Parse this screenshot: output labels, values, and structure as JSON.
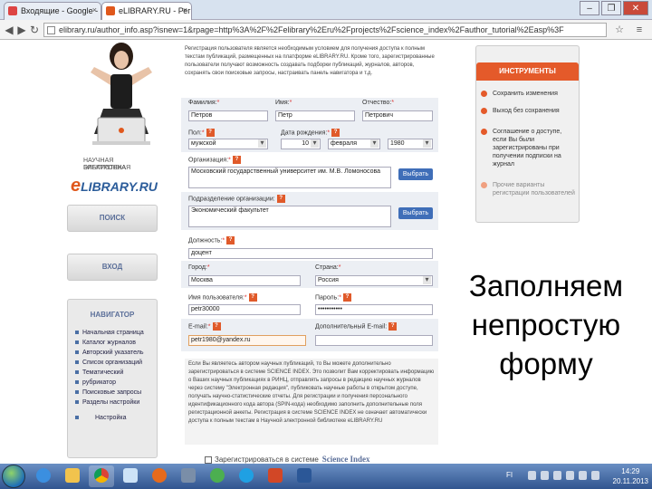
{
  "browser": {
    "tabs": [
      {
        "label": "Входящие - Google - мар",
        "active": false
      },
      {
        "label": "eLIBRARY.RU - Регистрац",
        "active": true
      }
    ],
    "url": "elibrary.ru/author_info.asp?isnew=1&rpage=http%3A%2F%2Felibrary%2Eru%2Fprojects%2Fscience_index%2Fauthor_tutorial%2Easp%3F",
    "window_buttons": {
      "minimize": "–",
      "maximize": "❐",
      "close": "✕"
    },
    "nav": {
      "back": "◀",
      "forward": "▶",
      "reload": "↻"
    }
  },
  "sidebar": {
    "logo_line1": "НАУЧНАЯ ЭЛЕКТРОННАЯ",
    "logo_line2": "БИБЛИОТЕКА",
    "logo_brand": "LIBRARY.RU",
    "logo_brand_e": "e",
    "search_label": "ПОИСК",
    "login_label": "ВХОД",
    "navigator": {
      "title": "НАВИГАТОР",
      "items": [
        "Начальная страница",
        "Каталог журналов",
        "Авторский указатель",
        "Список организаций",
        "Тематический",
        "рубрикатор",
        "Поисковые запросы",
        "Разделы настройки"
      ],
      "footer": "Настройка"
    }
  },
  "form": {
    "intro": "Регистрация пользователя является необходимым условием для получения доступа к полным текстам публикаций, размещенных на платформе eLIBRARY.RU. Кроме того, зарегистрированные пользователи получают возможность создавать подборки публикаций, журналов, авторов, сохранять свои поисковые запросы, настраивать панель навигатора и т.д.",
    "lastname": {
      "label": "Фамилия:",
      "value": "Петров"
    },
    "firstname": {
      "label": "Имя:",
      "value": "Петр"
    },
    "middlename": {
      "label": "Отчество:",
      "value": "Петрович"
    },
    "gender": {
      "label": "Пол:",
      "value": "мужской"
    },
    "birthdate": {
      "label": "Дата рождения:",
      "day": "10",
      "month": "февраля",
      "year": "1980"
    },
    "organization": {
      "label": "Организация:",
      "value": "Московский государственный университет им. М.В. Ломоносова",
      "button": "Выбрать"
    },
    "department": {
      "label": "Подразделение организации:",
      "value": "Экономический факультет",
      "button": "Выбрать"
    },
    "position": {
      "label": "Должность:",
      "value": "доцент"
    },
    "city": {
      "label": "Город:",
      "value": "Москва"
    },
    "country": {
      "label": "Страна:",
      "value": "Россия"
    },
    "username": {
      "label": "Имя пользователя:",
      "value": "petr30000"
    },
    "password": {
      "label": "Пароль:",
      "value": "•••••••••••"
    },
    "email": {
      "label": "E-mail:",
      "value": "petr1980@yandex.ru"
    },
    "extra_email": {
      "label": "Дополнительный E-mail:",
      "value": ""
    },
    "bottom_text": "Если Вы являетесь автором научных публикаций, то Вы можете дополнительно зарегистрироваться в системе SCIENCE INDEX. Это позволит Вам корректировать информацию о Ваших научных публикациях в РИНЦ, отправлять запросы в редакцию научных журналов через систему \"Электронная редакция\", публиковать научные работы в открытом доступе, получать научно-статистические отчеты. Для регистрации и получения персонального идентификационного кода автора (SPIN-кода) необходимо заполнить дополнительные поля регистрационной анкеты. Регистрация в системе SCIENCE INDEX не означает автоматически доступа к полным текстам в Научной электронной библиотеке eLIBRARY.RU",
    "science_index_check": "Зарегистрироваться в системе",
    "science_index_logo": "Science Index"
  },
  "instruments": {
    "title": "ИНСТРУМЕНТЫ",
    "items": [
      {
        "label": "Сохранить изменения",
        "dim": false
      },
      {
        "label": "Выход без сохранения",
        "dim": false
      },
      {
        "label": "Соглашение о доступе, если Вы были зарегистрированы при получении подписки на журнал",
        "dim": false
      },
      {
        "label": "Прочие варианты регистрации пользователей",
        "dim": true
      }
    ]
  },
  "caption": {
    "line1": "Заполняем",
    "line2": "непростую",
    "line3": "форму"
  },
  "taskbar": {
    "lang": "FI",
    "time": "14:29",
    "date": "20.11.2013"
  },
  "colors": {
    "accent_orange": "#e45a2a",
    "accent_blue": "#3f6eb8"
  }
}
